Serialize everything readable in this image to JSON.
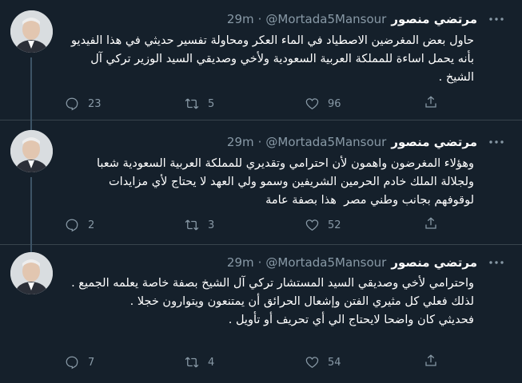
{
  "tweets": [
    {
      "name": "مرتضي منصور",
      "handle": "@Mortada5Mansour",
      "separator": "·",
      "time": "29m",
      "text": [
        "حاول بعض المغرضين الاصطياد في الماء العكر ومحاولة تفسير حديثي في هذا الفيديو بأنه يحمل اساءة للمملكة العربية السعودية ولأخي وصديقي السيد الوزير تركي آل الشيخ ."
      ],
      "replies": "23",
      "retweets": "5",
      "likes": "96"
    },
    {
      "name": "مرتضي منصور",
      "handle": "@Mortada5Mansour",
      "separator": "·",
      "time": "29m",
      "text": [
        "وهؤلاء المغرضون واهمون لأن احترامي وتقديري للمملكة العربية السعودية شعبا ولجلالة الملك خادم الحرمين الشريفين وسمو ولي العهد لا يحتاج لأي مزايدات لوقوفهم بجانب وطني مصر  هذا بصفة عامة"
      ],
      "replies": "2",
      "retweets": "3",
      "likes": "52"
    },
    {
      "name": "مرتضي منصور",
      "handle": "@Mortada5Mansour",
      "separator": "·",
      "time": "29m",
      "text": [
        "واحترامي لأخي وصديقي السيد المستشار تركي آل الشيخ بصفة خاصة يعلمه الجميع .",
        "لذلك فعلي كل مثيري الفتن وإشعال الحرائق أن يمتنعون ويتوارون خجلا .",
        "فحديثي كان واضحا لايحتاج الي أي تحريف أو تأويل ."
      ],
      "replies": "7",
      "retweets": "4",
      "likes": "54"
    }
  ],
  "icons": {
    "more": "more-icon",
    "reply": "reply-icon",
    "retweet": "retweet-icon",
    "like": "heart-icon",
    "share": "share-icon"
  },
  "colors": {
    "background": "#15202b",
    "divider": "#38444d",
    "secondary_text": "#8899a6",
    "thread_line": "#3d5466"
  }
}
